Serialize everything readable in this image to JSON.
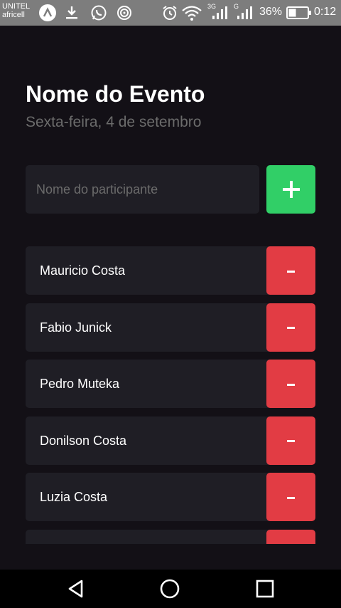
{
  "status_bar": {
    "carrier_1": "UNITEL",
    "carrier_2": "africell",
    "signal_3g": "3G",
    "signal_g": "G",
    "battery": "36%",
    "time": "0:12"
  },
  "header": {
    "title": "Nome do Evento",
    "subtitle": "Sexta-feira, 4 de setembro"
  },
  "form": {
    "placeholder": "Nome do participante",
    "add_label": "+"
  },
  "participants": [
    {
      "name": "Mauricio Costa",
      "remove_label": "-"
    },
    {
      "name": "Fabio Junick",
      "remove_label": "-"
    },
    {
      "name": "Pedro Muteka",
      "remove_label": "-"
    },
    {
      "name": "Donilson Costa",
      "remove_label": "-"
    },
    {
      "name": "Luzia Costa",
      "remove_label": "-"
    },
    {
      "name": "",
      "remove_label": "-"
    }
  ],
  "colors": {
    "background": "#131016",
    "card": "#1f1e25",
    "add": "#31cf67",
    "remove": "#e23c44",
    "muted_text": "#6b6b6b"
  }
}
